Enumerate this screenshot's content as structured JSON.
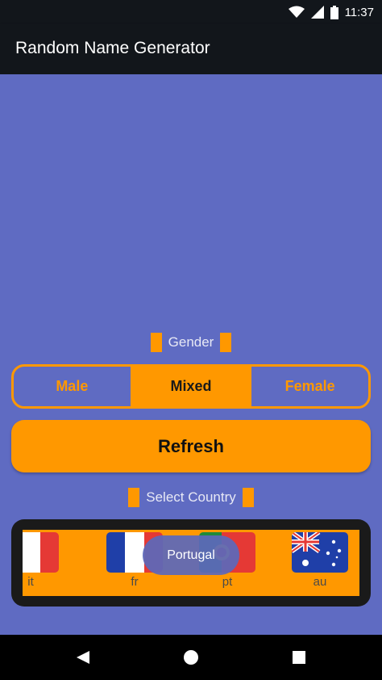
{
  "status_bar": {
    "time": "11:37",
    "icons": [
      "wifi-icon",
      "signal-icon",
      "battery-icon"
    ]
  },
  "app_bar": {
    "title": "Random Name Generator"
  },
  "gender": {
    "label": "Gender",
    "options": [
      "Male",
      "Mixed",
      "Female"
    ],
    "selected": "Mixed"
  },
  "refresh_label": "Refresh",
  "country": {
    "label": "Select Country",
    "items": [
      {
        "code": "it",
        "flag": "italy-flag-icon"
      },
      {
        "code": "fr",
        "flag": "france-flag-icon"
      },
      {
        "code": "pt",
        "flag": "portugal-flag-icon"
      },
      {
        "code": "au",
        "flag": "australia-flag-icon"
      }
    ]
  },
  "toast": "Portugal",
  "colors": {
    "accent": "#ff9800",
    "background": "#5f6bc2",
    "appbar": "#12161b"
  },
  "nav_bar": {
    "buttons": [
      "back-icon",
      "home-icon",
      "recents-icon"
    ]
  }
}
